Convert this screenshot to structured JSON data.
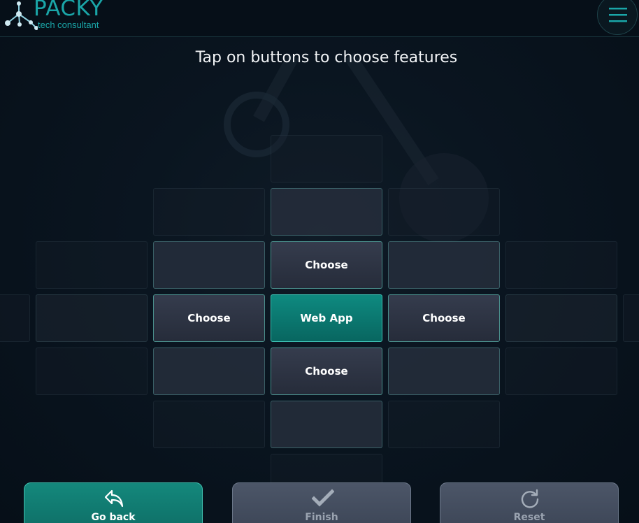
{
  "brand": {
    "name": "PACKY",
    "tagline": "tech consultant"
  },
  "header": {
    "menu_icon": "hamburger-icon"
  },
  "instructions": "Tap on buttons to choose features",
  "grid": {
    "center": "Web App",
    "choose_label": "Choose"
  },
  "actions": {
    "back": {
      "label": "Go back",
      "icon": "undo-arrow-icon"
    },
    "finish": {
      "label": "Finish",
      "icon": "checkmark-icon"
    },
    "reset": {
      "label": "Reset",
      "icon": "refresh-icon"
    }
  },
  "colors": {
    "accent": "#0e8a80",
    "brand": "#1aa6a8",
    "background": "#06101a"
  }
}
